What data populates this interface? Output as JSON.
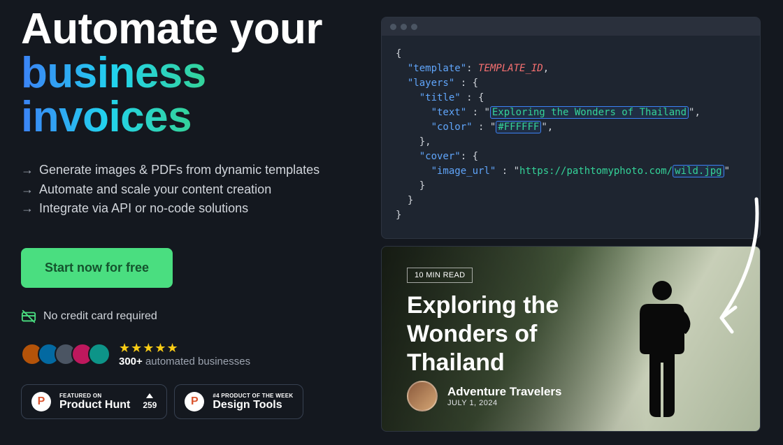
{
  "hero": {
    "line1": "Automate your",
    "line2a": "business",
    "line2b": "invoices"
  },
  "bullets": [
    "Generate images & PDFs from dynamic templates",
    "Automate and scale your content creation",
    "Integrate via API or no-code solutions"
  ],
  "cta_label": "Start now for free",
  "no_cc_text": "No credit card required",
  "social": {
    "stars": "★★★★★",
    "count": "300+",
    "suffix": "automated businesses"
  },
  "badges": {
    "ph": {
      "top": "FEATURED ON",
      "name": "Product Hunt",
      "votes": "259"
    },
    "dt": {
      "top": "#4 PRODUCT OF THE WEEK",
      "name": "Design Tools"
    }
  },
  "code": {
    "text_value": "Exploring the Wonders of Thailand",
    "color_value": "#FFFFFF",
    "image_url_prefix": "https://pathtomyphoto.com/",
    "image_url_file": "wild.jpg",
    "template_id": "TEMPLATE_ID"
  },
  "preview": {
    "read_time": "10 MIN READ",
    "title": "Exploring the Wonders of Thailand",
    "author": "Adventure Travelers",
    "date": "JULY 1, 2024"
  }
}
